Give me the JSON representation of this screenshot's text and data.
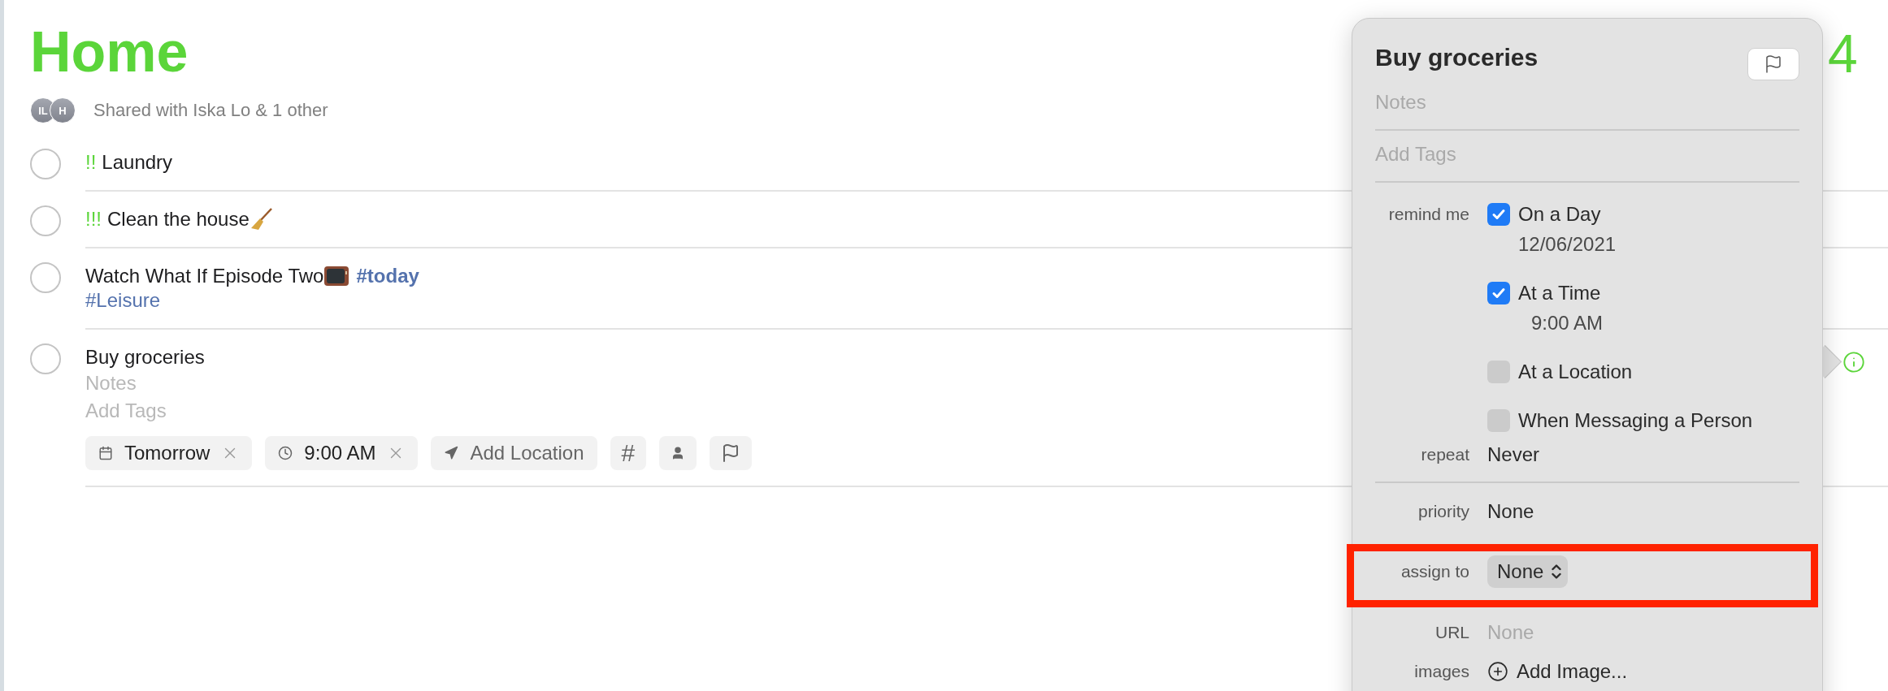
{
  "list": {
    "title": "Home",
    "count": "4",
    "avatars": [
      "IL",
      "H"
    ],
    "shared_text": "Shared with Iska Lo & 1 other"
  },
  "reminders": [
    {
      "kind": "plain",
      "completed": false,
      "priority": "!!",
      "title": "Laundry"
    },
    {
      "kind": "broom",
      "completed": false,
      "priority": "!!!",
      "title": "Clean the house"
    },
    {
      "kind": "tv",
      "completed": false,
      "title": "Watch What If Episode Two",
      "inline_tags": [
        "#today"
      ],
      "tags": [
        "#Leisure"
      ]
    },
    {
      "kind": "plain",
      "completed": false,
      "title": "Buy groceries",
      "notes_placeholder": "Notes",
      "tags_placeholder": "Add Tags",
      "info": true,
      "chips": [
        {
          "kind": "date",
          "label": "Tomorrow",
          "removable": true
        },
        {
          "kind": "time",
          "label": "9:00 AM",
          "removable": true
        },
        {
          "kind": "location",
          "label": "Add Location",
          "removable": false
        },
        {
          "kind": "tag",
          "label": "#",
          "removable": false
        },
        {
          "kind": "person",
          "removable": false
        },
        {
          "kind": "flag",
          "removable": false
        }
      ]
    }
  ],
  "details": {
    "title": "Buy groceries",
    "flagged": false,
    "notes_placeholder": "Notes",
    "tags_placeholder": "Add Tags",
    "remind_me": {
      "label": "remind me",
      "options": [
        {
          "label": "On a Day",
          "checked": true,
          "value": "12/06/2021"
        },
        {
          "label": "At a Time",
          "checked": true,
          "value": "9:00 AM"
        },
        {
          "label": "At a Location",
          "checked": false
        },
        {
          "label": "When Messaging a Person",
          "checked": false
        }
      ]
    },
    "repeat": {
      "label": "repeat",
      "value": "Never"
    },
    "priority": {
      "label": "priority",
      "value": "None"
    },
    "assign_to": {
      "label": "assign to",
      "value": "None",
      "highlighted": true
    },
    "url": {
      "label": "URL",
      "placeholder": "None"
    },
    "images": {
      "label": "images",
      "action": "Add Image..."
    }
  }
}
